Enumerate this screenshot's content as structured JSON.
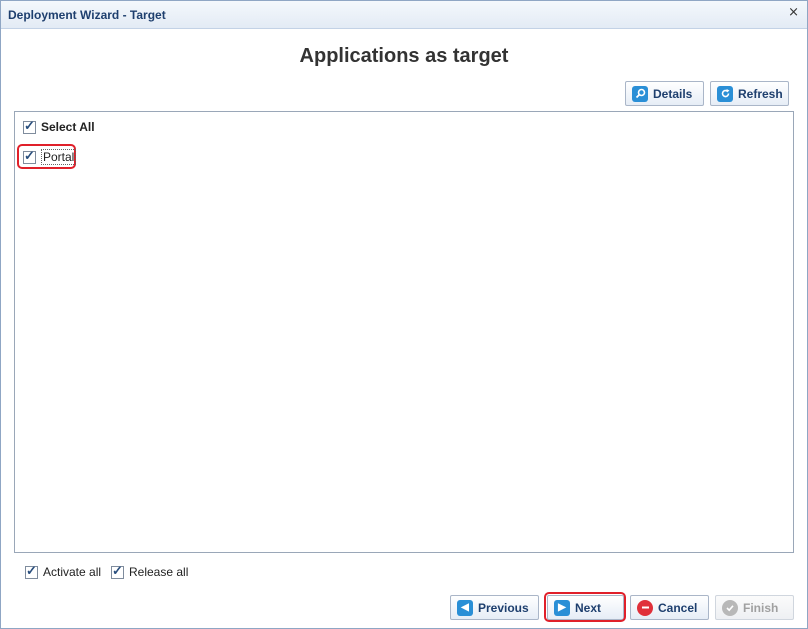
{
  "window": {
    "title": "Deployment Wizard - Target",
    "close_glyph": "×"
  },
  "page": {
    "heading": "Applications as target"
  },
  "toolbar": {
    "details_label": "Details",
    "details_icon": "magnifier-icon",
    "refresh_label": "Refresh",
    "refresh_icon": "refresh-icon"
  },
  "list": {
    "select_all_label": "Select All",
    "select_all_checked": true,
    "items": [
      {
        "label": "Portal",
        "checked": true
      }
    ]
  },
  "options": {
    "activate_all_label": "Activate all",
    "activate_all_checked": true,
    "release_all_label": "Release all",
    "release_all_checked": true
  },
  "footer": {
    "previous_label": "Previous",
    "next_label": "Next",
    "cancel_label": "Cancel",
    "finish_label": "Finish",
    "finish_enabled": false
  },
  "colors": {
    "accent": "#1e3f6e",
    "icon_blue": "#2a8fd6",
    "cancel_red": "#e0303a",
    "highlight_red": "#e0202a"
  }
}
